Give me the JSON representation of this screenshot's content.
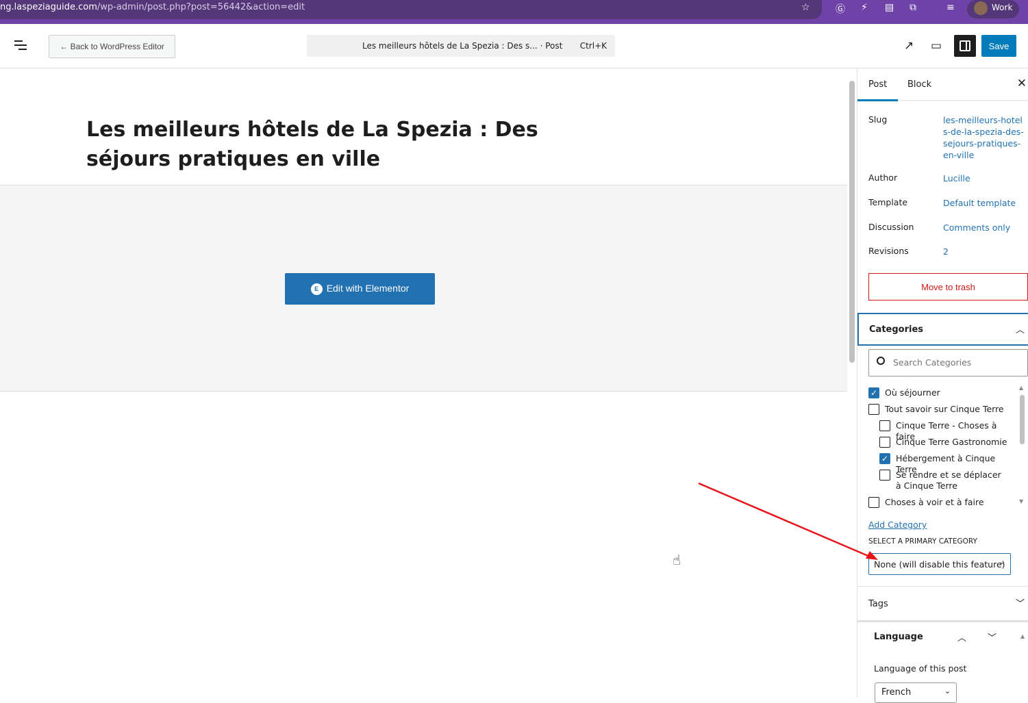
{
  "browser": {
    "url_host": "ng.laspeziaguide.com",
    "url_path": "/wp-admin/post.php?post=56442&action=edit",
    "profile": "Work"
  },
  "toolbar": {
    "back_label": "← Back to WordPress Editor",
    "command_title": "Les meilleurs hôtels de La Spezia : Des s...  · Post",
    "command_shortcut": "Ctrl+K",
    "save_label": "Save"
  },
  "post": {
    "title": "Les meilleurs hôtels de La Spezia : Des séjours pratiques en ville",
    "elementor_label": "Edit with Elementor"
  },
  "sidebar": {
    "tabs": [
      "Post",
      "Block"
    ],
    "fields": [
      {
        "label": "Slug",
        "value": "les-meilleurs-hotels-de-la-spezia-des-sejours-pratiques-en-ville"
      },
      {
        "label": "Author",
        "value": "Lucille"
      },
      {
        "label": "Template",
        "value": "Default template"
      },
      {
        "label": "Discussion",
        "value": "Comments only"
      },
      {
        "label": "Revisions",
        "value": "2"
      }
    ],
    "trash_label": "Move to trash",
    "categories": {
      "title": "Categories",
      "search_placeholder": "Search Categories",
      "items": [
        {
          "label": "Où séjourner",
          "checked": true
        },
        {
          "label": "Tout savoir sur Cinque Terre",
          "checked": false
        },
        {
          "label": "Cinque Terre - Choses à faire",
          "checked": false
        },
        {
          "label": "Cinque Terre Gastronomie",
          "checked": false
        },
        {
          "label": "Hébergement à Cinque Terre",
          "checked": true
        },
        {
          "label": "Se rendre et se déplacer à Cinque Terre",
          "checked": false
        },
        {
          "label": "Choses à voir et à faire",
          "checked": false
        }
      ],
      "add_label": "Add Category",
      "primary_label": "Select a primary category",
      "primary_value": "None (will disable this feature)"
    },
    "tags_title": "Tags",
    "language": {
      "title": "Language",
      "label": "Language of this post",
      "value": "French"
    }
  },
  "colors": {
    "accent": "#007cba",
    "chrome": "#6f42a8",
    "danger": "#cc1818"
  }
}
